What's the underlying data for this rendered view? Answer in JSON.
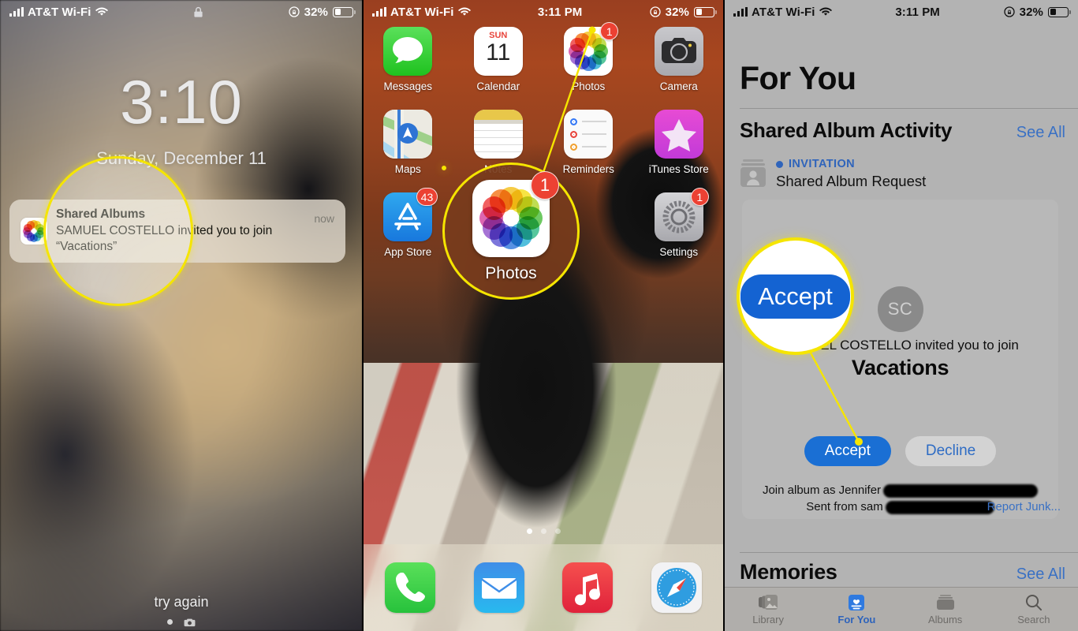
{
  "panels": {
    "lock": {
      "statusbar": {
        "carrier": "AT&T Wi-Fi",
        "center": "",
        "battery": "32%",
        "lock_icon": "lock-icon"
      },
      "time": "3:10",
      "date": "Sunday, December 11",
      "notification": {
        "app_icon": "photos-icon",
        "title": "Shared Albums",
        "body_line1": "SAMUEL COSTELLO invited you to join",
        "body_line2": "“Vacations”",
        "time": "now"
      },
      "try_again": "try again",
      "camera_icon": "camera-icon"
    },
    "home": {
      "statusbar": {
        "carrier": "AT&T Wi-Fi",
        "center": "3:11 PM",
        "battery": "32%"
      },
      "rows": [
        [
          {
            "label": "Messages",
            "icon": "messages-icon",
            "badge": ""
          },
          {
            "label": "Calendar",
            "icon": "calendar-icon",
            "badge": "",
            "cal_day_name": "SUN",
            "cal_day_num": "11"
          },
          {
            "label": "Photos",
            "icon": "photos-icon",
            "badge": "1"
          },
          {
            "label": "Camera",
            "icon": "camera-icon",
            "badge": ""
          }
        ],
        [
          {
            "label": "Maps",
            "icon": "maps-icon",
            "badge": ""
          },
          {
            "label": "Notes",
            "icon": "notes-icon",
            "badge": ""
          },
          {
            "label": "Reminders",
            "icon": "reminders-icon",
            "badge": ""
          },
          {
            "label": "iTunes Store",
            "icon": "itunes-store-icon",
            "badge": ""
          }
        ],
        [
          {
            "label": "App Store",
            "icon": "app-store-icon",
            "badge": "43"
          },
          {
            "label": "",
            "icon": "",
            "badge": ""
          },
          {
            "label": "",
            "icon": "",
            "badge": ""
          },
          {
            "label": "Settings",
            "icon": "settings-icon",
            "badge": "1"
          }
        ]
      ],
      "page_dots": 3,
      "active_page": 1,
      "dock": [
        {
          "label": "Phone",
          "icon": "phone-icon"
        },
        {
          "label": "Mail",
          "icon": "mail-icon"
        },
        {
          "label": "Music",
          "icon": "music-icon"
        },
        {
          "label": "Safari",
          "icon": "safari-icon"
        }
      ],
      "callout_label": "Photos",
      "callout_badge": "1"
    },
    "photos_app": {
      "statusbar": {
        "carrier": "AT&T Wi-Fi",
        "center": "3:11 PM",
        "battery": "32%"
      },
      "page_title": "For You",
      "sections": [
        {
          "title": "Shared Album Activity",
          "see_all": "See All"
        },
        {
          "title": "Memories",
          "see_all": "See All"
        }
      ],
      "invitation": {
        "kicker": "INVITATION",
        "name": "Shared Album Request",
        "icon": "contact-card-icon"
      },
      "card": {
        "avatar_initials": "SC",
        "inviter_line": "SAMUEL COSTELLO invited you to join",
        "album_name": "Vacations",
        "accept_label": "Accept",
        "decline_label": "Decline",
        "join_as_prefix": "Join album as Jennifer",
        "sent_from_prefix": "Sent from sam",
        "report_junk": "Report Junk..."
      },
      "tabs": [
        {
          "label": "Library",
          "icon": "library-icon",
          "active": false
        },
        {
          "label": "For You",
          "icon": "for-you-icon",
          "active": true
        },
        {
          "label": "Albums",
          "icon": "albums-icon",
          "active": false
        },
        {
          "label": "Search",
          "icon": "search-icon",
          "active": false
        }
      ],
      "callout_accept_label": "Accept"
    }
  },
  "colors": {
    "accent_blue": "#1a6fd4",
    "link_blue": "#3a71c4",
    "badge_red": "#ec4133",
    "callout_yellow": "#f5e500"
  }
}
